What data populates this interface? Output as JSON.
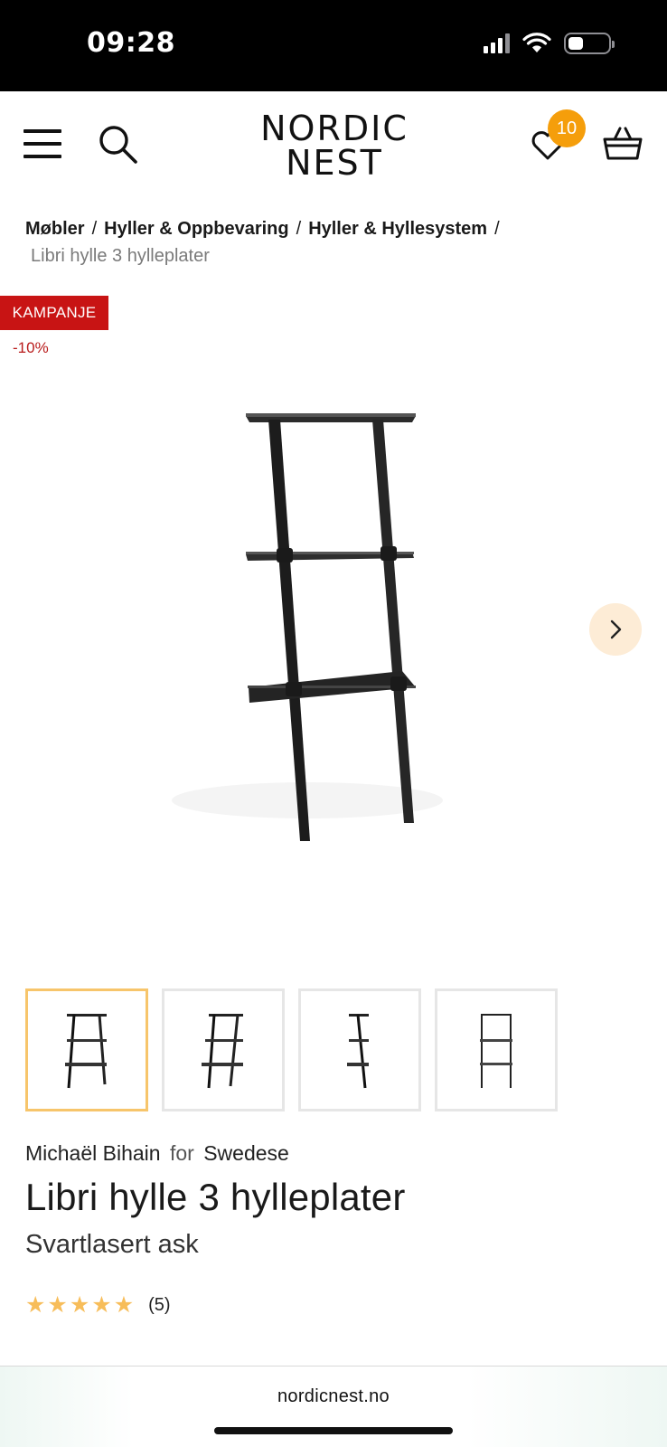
{
  "status_bar": {
    "time": "09:28",
    "icons": [
      "signal-icon",
      "wifi-icon",
      "battery-icon"
    ]
  },
  "header": {
    "logo_line1": "NORDIC",
    "logo_line2": "NEST",
    "wishlist_count": "10",
    "icons": [
      "menu-icon",
      "search-icon",
      "heart-icon",
      "basket-icon"
    ],
    "badge_color": "#f59e0b"
  },
  "breadcrumb": {
    "items": [
      "Møbler",
      "Hyller & Oppbevaring",
      "Hyller & Hyllesystem"
    ],
    "separator": "/",
    "current": "Libri hylle 3 hylleplater"
  },
  "campaign": {
    "label": "KAMPANJE",
    "discount": "-10%",
    "color": "#c81414"
  },
  "gallery": {
    "next_icon": "chevron-right-icon",
    "thumbnail_count": 4,
    "active_thumbnail": 0,
    "active_color": "#f7c56b"
  },
  "product": {
    "designer": "Michaël Bihain",
    "for_text": "for",
    "brand": "Swedese",
    "title": "Libri hylle 3 hylleplater",
    "variant": "Svartlasert ask",
    "rating": 5,
    "review_count": "(5)",
    "star_color": "#f7bd5a"
  },
  "browser": {
    "url": "nordicnest.no"
  }
}
